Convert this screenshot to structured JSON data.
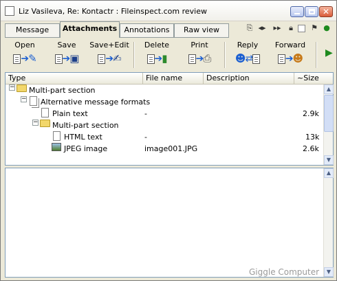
{
  "window": {
    "title": "Liz Vasileva, Re: Kontactr : Fileinspect.com review",
    "buttons": [
      "minimize",
      "maximize",
      "close"
    ]
  },
  "tabs": [
    {
      "label": "Message",
      "active": false
    },
    {
      "label": "Attachments",
      "active": true
    },
    {
      "label": "Annotations",
      "active": false
    },
    {
      "label": "Raw view",
      "active": false
    }
  ],
  "tab_tools": [
    "attachment-icon",
    "prev-next-icon",
    "fast-forward-icon",
    "lock-icon",
    "checkbox-icon",
    "flag-icon",
    "traffic-light-icon"
  ],
  "toolbar": {
    "open_label": "Open",
    "save_label": "Save",
    "save_edit_label": "Save+Edit",
    "delete_label": "Delete",
    "print_label": "Print",
    "reply_label": "Reply",
    "forward_label": "Forward"
  },
  "columns": {
    "type": "Type",
    "file_name": "File name",
    "description": "Description",
    "size": "~Size"
  },
  "rows": [
    {
      "type": "Multi-part section",
      "file_name": "",
      "size": ""
    },
    {
      "type": "Alternative message formats",
      "file_name": "",
      "size": ""
    },
    {
      "type": "Plain text",
      "file_name": "-",
      "size": "2.9k"
    },
    {
      "type": "Multi-part section",
      "file_name": "",
      "size": ""
    },
    {
      "type": "HTML text",
      "file_name": "-",
      "size": "13k"
    },
    {
      "type": "JPEG image",
      "file_name": "image001.JPG",
      "size": "2.6k"
    }
  ],
  "watermark": "Giggle Computer",
  "colors": {
    "accent": "#316ac5",
    "arrow": "#1c5fd1",
    "folder": "#f2d76b"
  }
}
